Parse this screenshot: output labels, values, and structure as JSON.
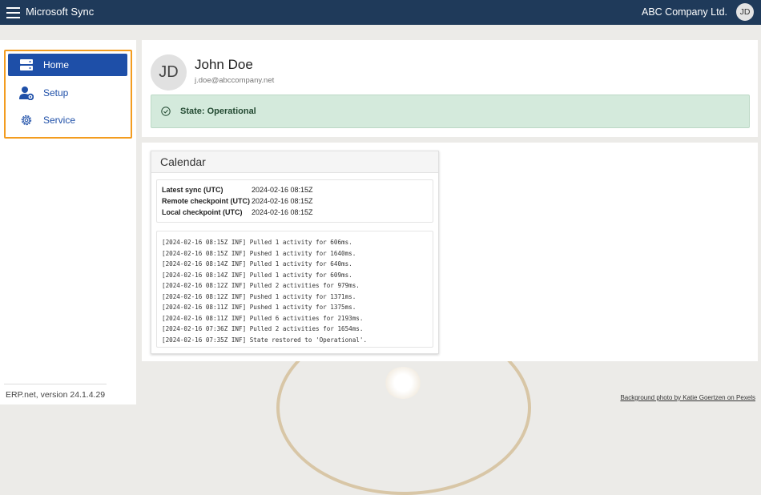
{
  "header": {
    "app_title": "Microsoft Sync",
    "company": "ABC Company Ltd.",
    "avatar_initials": "JD"
  },
  "sidebar": {
    "items": [
      {
        "label": "Home",
        "icon": "server-icon",
        "active": true
      },
      {
        "label": "Setup",
        "icon": "user-settings-icon",
        "active": false
      },
      {
        "label": "Service",
        "icon": "gear-icon",
        "active": false
      }
    ],
    "version": "ERP.net, version 24.1.4.29",
    "highlight_color": "#f39c1f",
    "active_color": "#1e4fa8"
  },
  "user": {
    "initials": "JD",
    "name": "John Doe",
    "email": "j.doe@abccompany.net",
    "state": "State: Operational",
    "state_color": "#d4eadc"
  },
  "calendar": {
    "title": "Calendar",
    "sync_rows": [
      {
        "label": "Latest sync (UTC)",
        "value": "2024-02-16 08:15Z"
      },
      {
        "label": "Remote checkpoint (UTC)",
        "value": "2024-02-16 08:15Z"
      },
      {
        "label": "Local checkpoint (UTC)",
        "value": "2024-02-16 08:15Z"
      }
    ],
    "log": [
      "[2024-02-16 08:15Z INF] Pulled 1 activity for 606ms.",
      "[2024-02-16 08:15Z INF] Pushed 1 activity for 1640ms.",
      "[2024-02-16 08:14Z INF] Pulled 1 activity for 640ms.",
      "[2024-02-16 08:14Z INF] Pulled 1 activity for 609ms.",
      "[2024-02-16 08:12Z INF] Pulled 2 activities for 979ms.",
      "[2024-02-16 08:12Z INF] Pushed 1 activity for 1371ms.",
      "[2024-02-16 08:11Z INF] Pushed 1 activity for 1375ms.",
      "[2024-02-16 08:11Z INF] Pulled 6 activities for 2193ms.",
      "[2024-02-16 07:36Z INF] Pulled 2 activities for 1654ms.",
      "[2024-02-16 07:35Z INF] State restored to 'Operational'."
    ]
  },
  "footer": {
    "credit": "Background photo by Katie Goertzen on Pexels"
  }
}
